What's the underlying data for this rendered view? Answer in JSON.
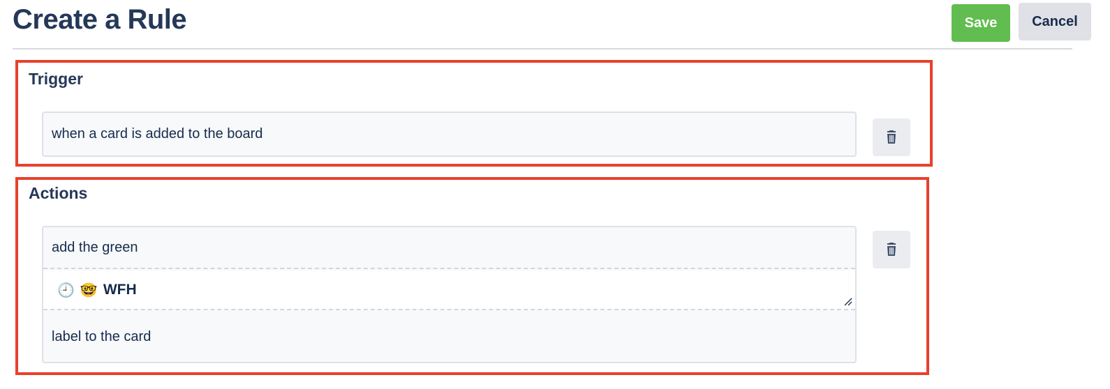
{
  "header": {
    "title": "Create a Rule",
    "save_label": "Save",
    "cancel_label": "Cancel"
  },
  "trigger": {
    "title": "Trigger",
    "text": "when a card is added to the board",
    "delete_icon": "trash-icon"
  },
  "actions": {
    "title": "Actions",
    "prefix_text": "add the green",
    "label": {
      "emojis": [
        "🕘",
        "🤓"
      ],
      "name": "WFH"
    },
    "suffix_text": "label to the card",
    "delete_icon": "trash-icon"
  },
  "colors": {
    "save": "#61bd4f",
    "highlight_border": "#e8412c",
    "cancel_bg": "#dfe1e6"
  }
}
